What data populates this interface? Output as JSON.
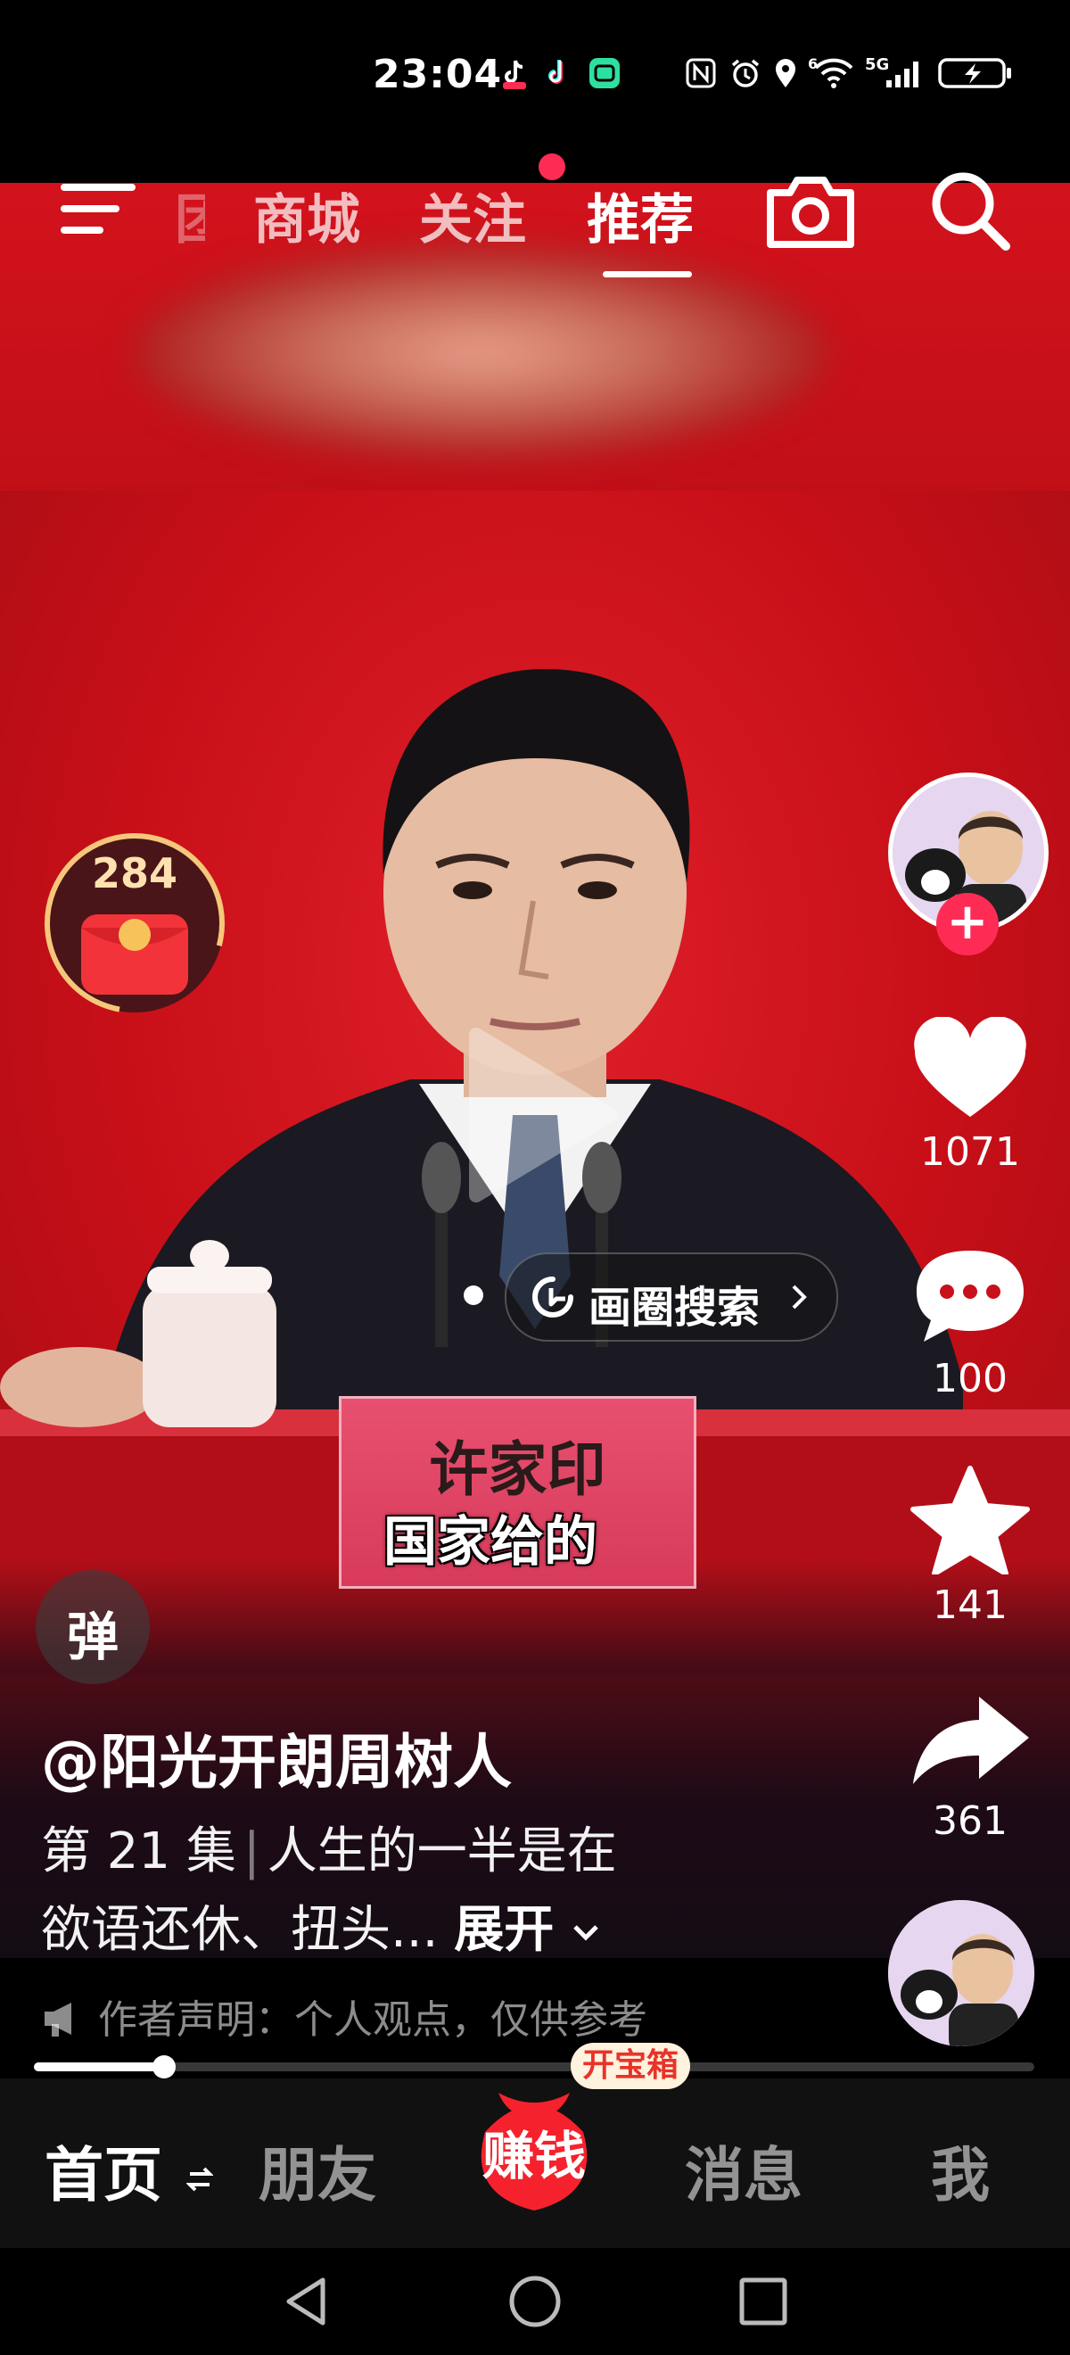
{
  "status_bar": {
    "time": "23:04",
    "network_5g": "5G",
    "network_6": "6"
  },
  "top_nav": {
    "partial_tab": "团",
    "tabs": [
      {
        "label": "商城",
        "active": false
      },
      {
        "label": "关注",
        "active": false,
        "has_dot": true
      },
      {
        "label": "推荐",
        "active": true
      }
    ]
  },
  "red_packet": {
    "count": "284"
  },
  "sidebar": {
    "like_count": "1071",
    "comment_count": "100",
    "favorite_count": "141",
    "share_count": "361"
  },
  "video": {
    "nameplate_text": "许家印",
    "subtitle": "国家给的",
    "circle_search_label": "画圈搜索",
    "danmu_label": "弹"
  },
  "post": {
    "author": "@阳光开朗周树人",
    "episode": "第 21 集",
    "description_line1": "人生的一半是在",
    "description_line2": "欲语还休、扭头...",
    "expand_label": "展开",
    "disclaimer": "作者声明：个人观点，仅供参考",
    "progress": 0.13
  },
  "tab_bar": {
    "home": "首页",
    "friends": "朋友",
    "earn": "赚钱",
    "earn_badge": "开宝箱",
    "messages": "消息",
    "me": "我"
  },
  "colors": {
    "accent": "#fe2c55",
    "video_bg": "#c8111a",
    "tab_bar_bg": "#111111"
  }
}
